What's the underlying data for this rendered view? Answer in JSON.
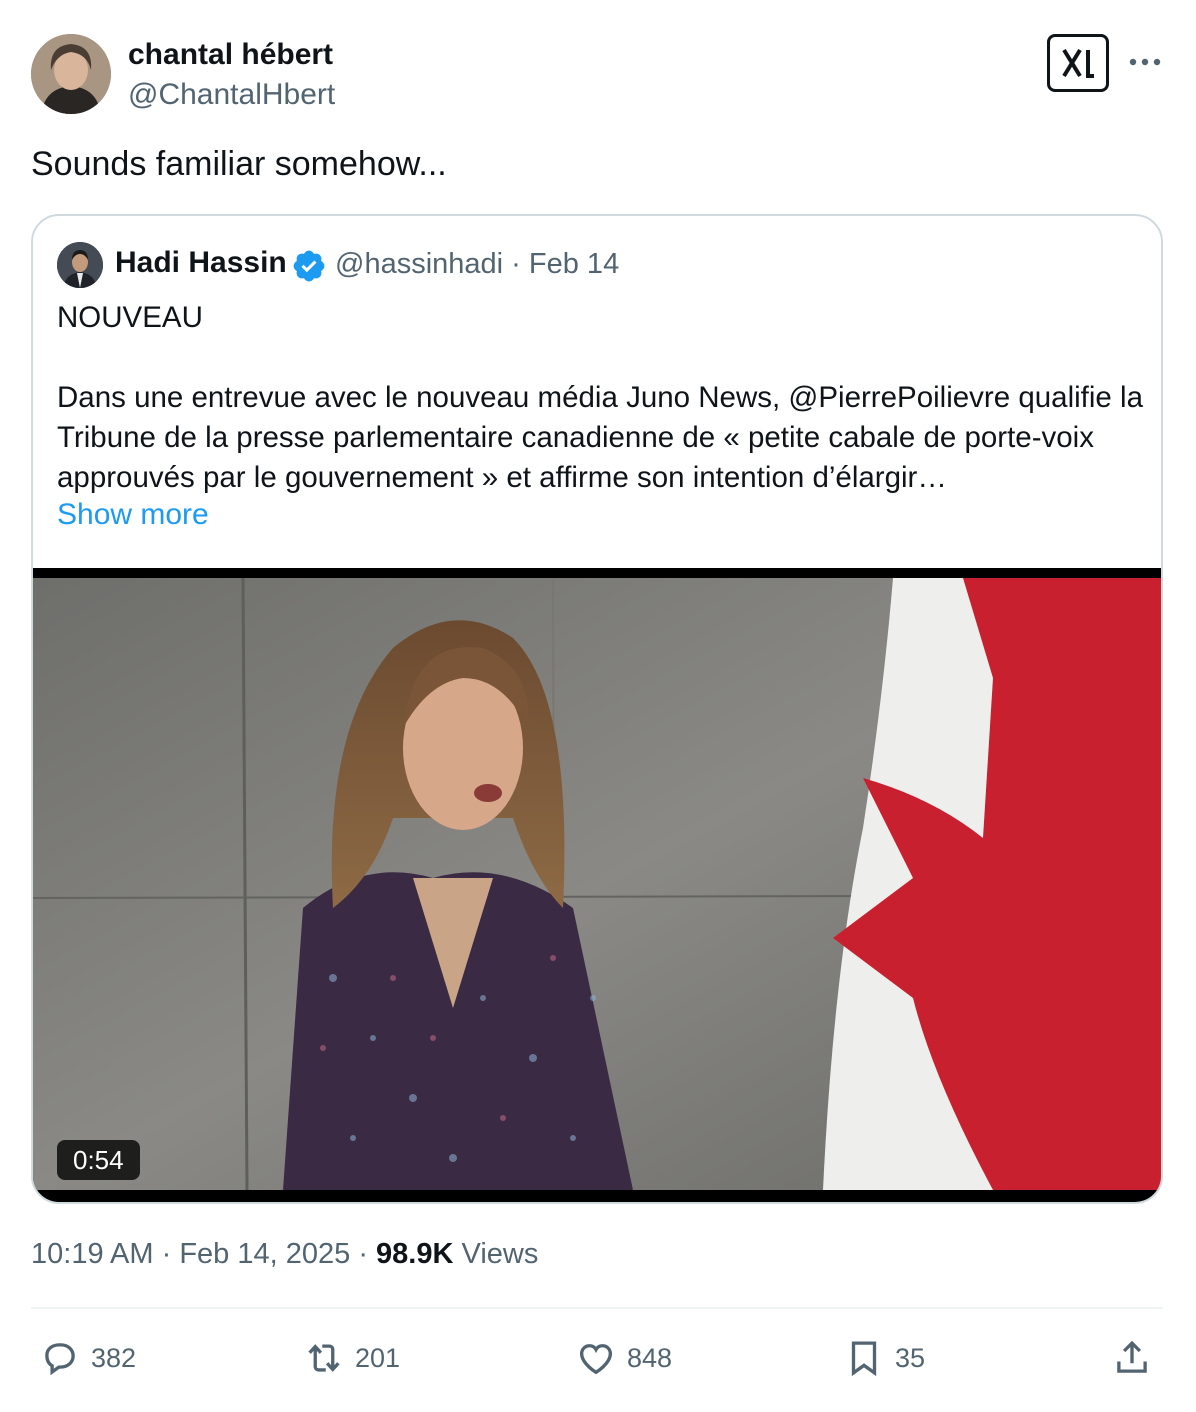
{
  "author": {
    "name": "chantal hébert",
    "handle": "@ChantalHbert"
  },
  "tweet": {
    "text": "Sounds familiar somehow..."
  },
  "quote": {
    "name": "Hadi Hassin",
    "handle": "@hassinhadi",
    "separator": "·",
    "date": "Feb 14",
    "body": "NOUVEAU\n\nDans une entrevue avec le nouveau média Juno News, @PierrePoilievre qualifie la Tribune de la presse parlementaire canadienne de « petite cabale de porte-voix approuvés par le gouvernement » et affirme son intention d’élargir…",
    "show_more": "Show more",
    "video_duration": "0:54"
  },
  "meta": {
    "time": "10:19 AM",
    "date": "Feb 14, 2025",
    "views_count": "98.9K",
    "views_label": "Views",
    "separator": "·"
  },
  "actions": {
    "replies": "382",
    "reposts": "201",
    "likes": "848",
    "bookmarks": "35"
  },
  "colors": {
    "text": "#0f1419",
    "secondary": "#536471",
    "link": "#1d9bf0",
    "border": "#cfd9de",
    "flag_red": "#c8202f"
  },
  "icons": [
    "grok-icon",
    "more-icon",
    "verified-badge-icon",
    "reply-icon",
    "repost-icon",
    "like-icon",
    "bookmark-icon",
    "share-icon"
  ]
}
